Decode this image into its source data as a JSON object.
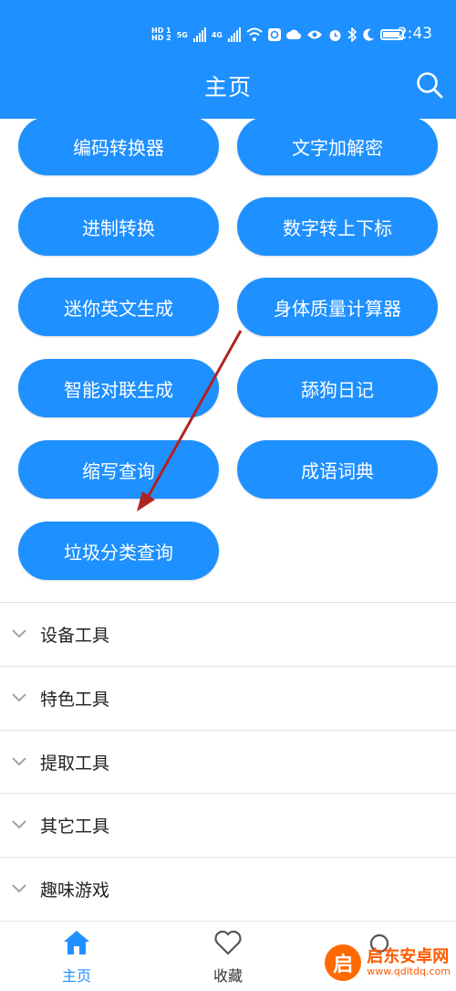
{
  "status_bar": {
    "time": "2:43",
    "network_5g": "5G",
    "network_4g": "4G",
    "hd1": "HD 1",
    "hd2": "HD 2"
  },
  "header": {
    "title": "主页",
    "search_icon": "search-icon"
  },
  "tool_buttons": [
    "编码转换器",
    "文字加解密",
    "进制转换",
    "数字转上下标",
    "迷你英文生成",
    "身体质量计算器",
    "智能对联生成",
    "舔狗日记",
    "缩写查询",
    "成语词典",
    "垃圾分类查询"
  ],
  "sections": [
    "设备工具",
    "特色工具",
    "提取工具",
    "其它工具",
    "趣味游戏"
  ],
  "bottom_nav": {
    "home": "主页",
    "favorites": "收藏"
  },
  "watermark": {
    "name": "启东安卓网",
    "url": "www.qdltdq.com",
    "logo_char": "启"
  },
  "colors": {
    "accent": "#1e90ff",
    "arrow": "#b22222"
  }
}
